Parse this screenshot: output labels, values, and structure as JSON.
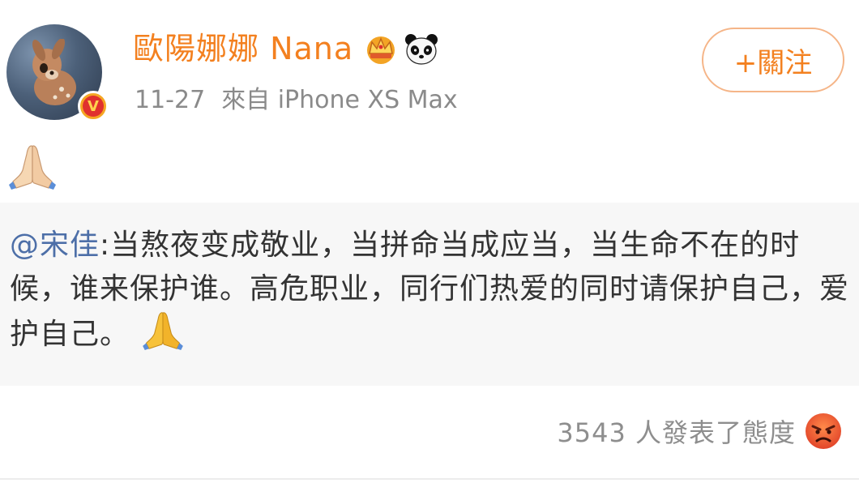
{
  "user": {
    "name": "歐陽娜娜 Nana",
    "verified_mark": "V",
    "badges": [
      "crown-icon",
      "panda-icon"
    ]
  },
  "meta": {
    "date": "11-27",
    "source": "來自 iPhone XS Max"
  },
  "follow_button": {
    "label": "+關注"
  },
  "post": {
    "emoji": "folded-hands-icon"
  },
  "repost": {
    "mention": "@宋佳",
    "text": ":当熬夜变成敬业，当拼命当成应当，当生命不在的时候，谁来保护谁。高危职业，同行们热爱的同时请保护自己，爱护自己。"
  },
  "reaction": {
    "label": "3543 人發表了態度",
    "icon": "angry-face-icon"
  },
  "colors": {
    "accent": "#f3801f",
    "mention": "#4d6fa8",
    "meta": "#8a8a8a",
    "repost_bg": "#f7f7f7"
  }
}
